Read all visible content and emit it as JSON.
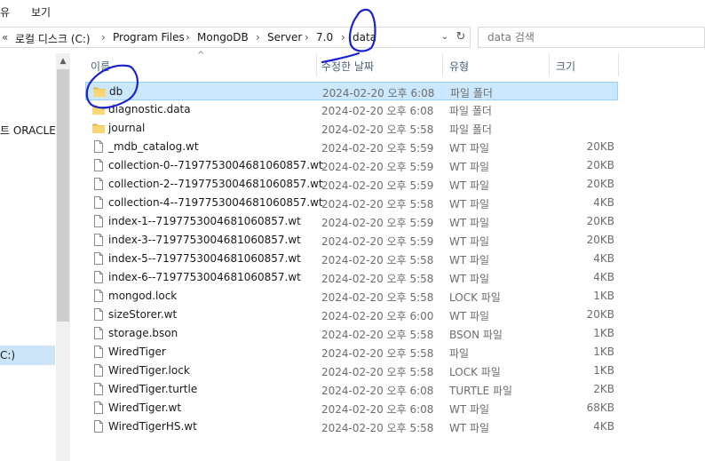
{
  "menu": {
    "item_partial": "유",
    "view": "보기"
  },
  "address": {
    "overflow": "«",
    "crumbs": [
      "로컬 디스크 (C:)",
      "Program Files",
      "MongoDB",
      "Server",
      "7.0",
      "data"
    ]
  },
  "search": {
    "placeholder": "data 검색"
  },
  "nav": {
    "oracle_item": "트 ORACLE",
    "drive_item": "C:)"
  },
  "columns": {
    "name": "이름",
    "date": "수정한 날짜",
    "type": "유형",
    "size": "크기"
  },
  "files": [
    {
      "name": "db",
      "date": "2024-02-20 오후 6:08",
      "type": "파일 폴더",
      "size": "",
      "kind": "folder",
      "selected": true
    },
    {
      "name": "diagnostic.data",
      "date": "2024-02-20 오후 6:08",
      "type": "파일 폴더",
      "size": "",
      "kind": "folder"
    },
    {
      "name": "journal",
      "date": "2024-02-20 오후 5:58",
      "type": "파일 폴더",
      "size": "",
      "kind": "folder"
    },
    {
      "name": "_mdb_catalog.wt",
      "date": "2024-02-20 오후 5:59",
      "type": "WT 파일",
      "size": "20KB",
      "kind": "file"
    },
    {
      "name": "collection-0--7197753004681060857.wt",
      "date": "2024-02-20 오후 5:59",
      "type": "WT 파일",
      "size": "20KB",
      "kind": "file"
    },
    {
      "name": "collection-2--7197753004681060857.wt",
      "date": "2024-02-20 오후 5:59",
      "type": "WT 파일",
      "size": "20KB",
      "kind": "file"
    },
    {
      "name": "collection-4--7197753004681060857.wt",
      "date": "2024-02-20 오후 5:58",
      "type": "WT 파일",
      "size": "4KB",
      "kind": "file"
    },
    {
      "name": "index-1--7197753004681060857.wt",
      "date": "2024-02-20 오후 5:59",
      "type": "WT 파일",
      "size": "20KB",
      "kind": "file"
    },
    {
      "name": "index-3--7197753004681060857.wt",
      "date": "2024-02-20 오후 5:59",
      "type": "WT 파일",
      "size": "20KB",
      "kind": "file"
    },
    {
      "name": "index-5--7197753004681060857.wt",
      "date": "2024-02-20 오후 5:58",
      "type": "WT 파일",
      "size": "4KB",
      "kind": "file"
    },
    {
      "name": "index-6--7197753004681060857.wt",
      "date": "2024-02-20 오후 5:58",
      "type": "WT 파일",
      "size": "4KB",
      "kind": "file"
    },
    {
      "name": "mongod.lock",
      "date": "2024-02-20 오후 5:58",
      "type": "LOCK 파일",
      "size": "1KB",
      "kind": "file"
    },
    {
      "name": "sizeStorer.wt",
      "date": "2024-02-20 오후 6:00",
      "type": "WT 파일",
      "size": "20KB",
      "kind": "file"
    },
    {
      "name": "storage.bson",
      "date": "2024-02-20 오후 5:58",
      "type": "BSON 파일",
      "size": "1KB",
      "kind": "file"
    },
    {
      "name": "WiredTiger",
      "date": "2024-02-20 오후 5:58",
      "type": "파일",
      "size": "1KB",
      "kind": "file"
    },
    {
      "name": "WiredTiger.lock",
      "date": "2024-02-20 오후 5:58",
      "type": "LOCK 파일",
      "size": "1KB",
      "kind": "file"
    },
    {
      "name": "WiredTiger.turtle",
      "date": "2024-02-20 오후 6:08",
      "type": "TURTLE 파일",
      "size": "2KB",
      "kind": "file"
    },
    {
      "name": "WiredTiger.wt",
      "date": "2024-02-20 오후 6:08",
      "type": "WT 파일",
      "size": "68KB",
      "kind": "file"
    },
    {
      "name": "WiredTigerHS.wt",
      "date": "2024-02-20 오후 5:58",
      "type": "WT 파일",
      "size": "4KB",
      "kind": "file"
    }
  ],
  "colors": {
    "selection_bg": "#cce8ff",
    "selection_border": "#99d1ff",
    "folder": "#f8d775",
    "annotation_ink": "#1a22d0"
  }
}
